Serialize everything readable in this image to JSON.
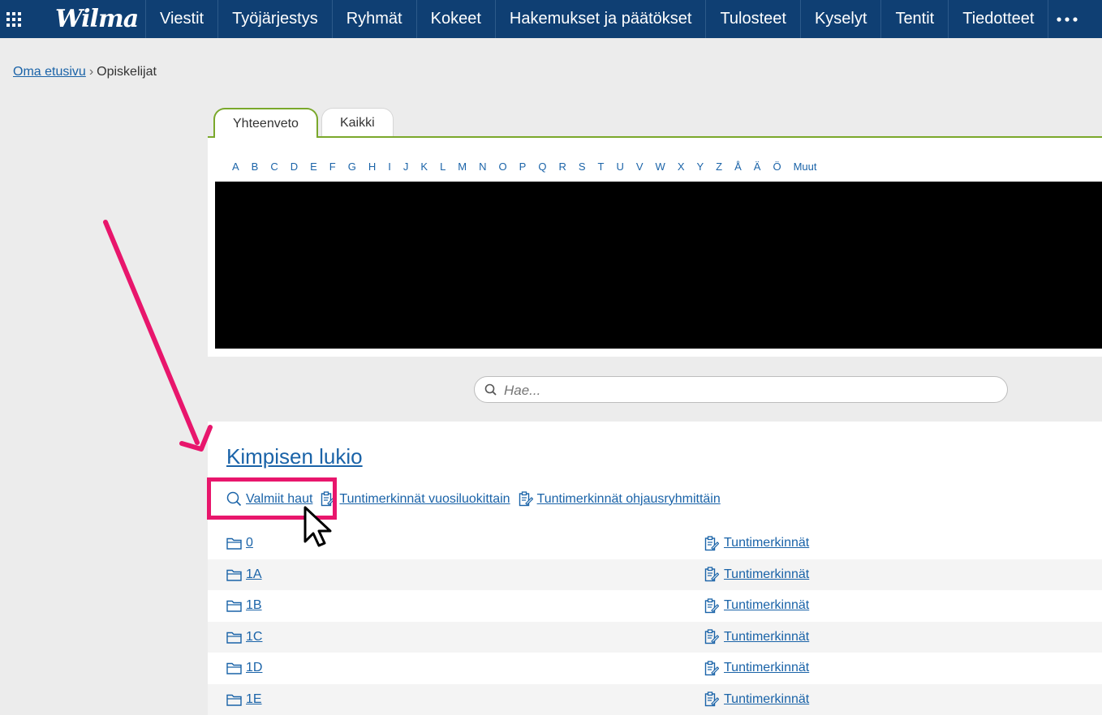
{
  "nav": {
    "logo": "Wilma",
    "items": [
      "Viestit",
      "Työjärjestys",
      "Ryhmät",
      "Kokeet",
      "Hakemukset ja päätökset",
      "Tulosteet",
      "Kyselyt",
      "Tentit",
      "Tiedotteet"
    ],
    "apps_icon": "grid-icon",
    "more_icon": "more-dots-icon"
  },
  "breadcrumb": {
    "home": "Oma etusivu",
    "current": "Opiskelijat"
  },
  "tabs": [
    "Yhteenveto",
    "Kaikki"
  ],
  "alphabet": [
    "A",
    "B",
    "C",
    "D",
    "E",
    "F",
    "G",
    "H",
    "I",
    "J",
    "K",
    "L",
    "M",
    "N",
    "O",
    "P",
    "Q",
    "R",
    "S",
    "T",
    "U",
    "V",
    "W",
    "X",
    "Y",
    "Z",
    "Å",
    "Ä",
    "Ö",
    "Muut"
  ],
  "search": {
    "placeholder": "Hae..."
  },
  "school": {
    "title": "Kimpisen lukio",
    "links": [
      "Valmiit haut",
      "Tuntimerkinnät vuosiluokittain",
      "Tuntimerkinnät ohjausryhmittäin"
    ],
    "rows": [
      {
        "class": "0",
        "action": "Tuntimerkinnät"
      },
      {
        "class": "1A",
        "action": "Tuntimerkinnät"
      },
      {
        "class": "1B",
        "action": "Tuntimerkinnät"
      },
      {
        "class": "1C",
        "action": "Tuntimerkinnät"
      },
      {
        "class": "1D",
        "action": "Tuntimerkinnät"
      },
      {
        "class": "1E",
        "action": "Tuntimerkinnät"
      }
    ]
  },
  "colors": {
    "nav": "#0f3f73",
    "accent_tab": "#7aa82b",
    "link": "#1a63a8",
    "annotation": "#e8166c"
  }
}
